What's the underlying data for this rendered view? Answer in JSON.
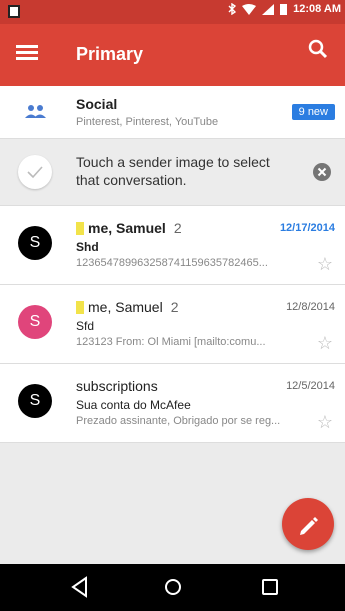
{
  "status_bar": {
    "time": "12:08 AM"
  },
  "app_bar": {
    "title": "Primary"
  },
  "social": {
    "title": "Social",
    "subtitle": "Pinterest, Pinterest, YouTube",
    "badge": "9 new"
  },
  "tip": {
    "text": "Touch a sender image to select that conversation."
  },
  "emails": [
    {
      "avatar_letter": "S",
      "avatar_color": "#000000",
      "sender": "me, Samuel",
      "count": "2",
      "date": "12/17/2014",
      "unread": true,
      "subject": "Shd",
      "snippet": "123654789963258741159635782465..."
    },
    {
      "avatar_letter": "S",
      "avatar_color": "#e0457b",
      "sender": "me, Samuel",
      "count": "2",
      "date": "12/8/2014",
      "unread": false,
      "subject": "Sfd",
      "snippet": "123123 From: Ol Miami [mailto:comu..."
    },
    {
      "avatar_letter": "S",
      "avatar_color": "#000000",
      "sender": "subscriptions",
      "count": "",
      "date": "12/5/2014",
      "unread": false,
      "subject": "Sua conta do McAfee",
      "snippet": "Prezado assinante, Obrigado por se reg..."
    }
  ],
  "colors": {
    "app_bar": "#db4437",
    "status_bar": "#c73a30",
    "badge": "#2b7de1",
    "fab": "#db4437"
  },
  "icons": {
    "menu": "menu-icon",
    "search": "search-icon",
    "compose": "pencil-icon",
    "star": "star-outline-icon"
  }
}
